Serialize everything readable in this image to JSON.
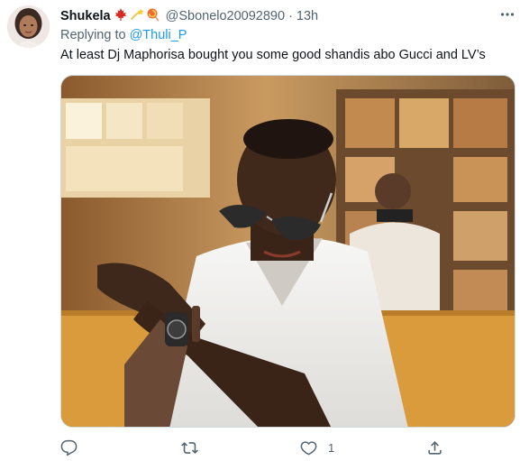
{
  "tweet": {
    "author_name": "Shukela",
    "emoji_icons": [
      "maple-leaf-icon",
      "dizzy-star-icon",
      "lollipop-icon"
    ],
    "handle": "@Sbonelo20092890",
    "separator": "·",
    "time": "13h",
    "more_icon": "more-dots-icon",
    "replying_prefix": "Replying to",
    "replying_to": "@Thuli_P",
    "text": "At least Dj Maphorisa bought you some good shandis abo Gucci and LV’s",
    "actions": {
      "reply_icon": "reply-bubble-icon",
      "retweet_icon": "retweet-icon",
      "like_icon": "heart-icon",
      "like_count": "1",
      "share_icon": "share-icon"
    },
    "colors": {
      "link": "#1d9bf0",
      "secondary_text": "#536471",
      "primary_text": "#0f1419"
    }
  }
}
